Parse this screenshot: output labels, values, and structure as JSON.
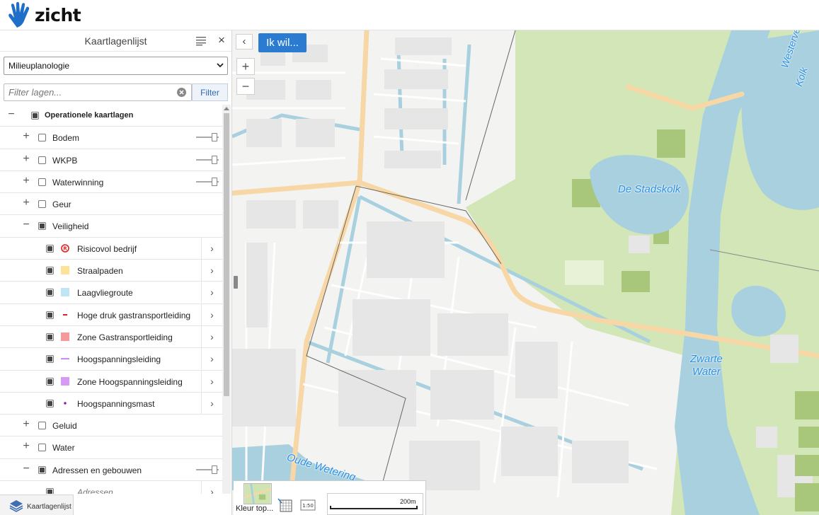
{
  "header": {
    "logo_text": "zicht",
    "logo_icon": "hand-icon"
  },
  "panel": {
    "title": "Kaartlagenlijst",
    "menu_icon": "list-icon",
    "close_label": "×",
    "theme_select": {
      "value": "Milieuplanologie"
    },
    "filter": {
      "placeholder": "Filter lagen...",
      "button_label": "Filter"
    },
    "footer_tab_label": "Kaartlagenlijst"
  },
  "tree": {
    "root": {
      "label": "Operationele kaartlagen",
      "checked": true,
      "expanded": true
    },
    "groups": [
      {
        "label": "Bodem",
        "checked": false,
        "expanded": false,
        "has_slider": true
      },
      {
        "label": "WKPB",
        "checked": false,
        "expanded": false,
        "has_slider": true
      },
      {
        "label": "Waterwinning",
        "checked": false,
        "expanded": false,
        "has_slider": true
      },
      {
        "label": "Geur",
        "checked": false,
        "expanded": false,
        "has_slider": false
      },
      {
        "label": "Veiligheid",
        "checked": true,
        "expanded": true,
        "has_slider": false
      },
      {
        "label": "Geluid",
        "checked": false,
        "expanded": false,
        "has_slider": false
      },
      {
        "label": "Water",
        "checked": false,
        "expanded": false,
        "has_slider": false
      },
      {
        "label": "Adressen en gebouwen",
        "checked": true,
        "expanded": true,
        "has_slider": true
      }
    ],
    "veiligheid_layers": [
      {
        "label": "Risicovol bedrijf",
        "checked": true,
        "legend": "risk-symbol",
        "color": "#e02020"
      },
      {
        "label": "Straalpaden",
        "checked": true,
        "legend": "fill",
        "color": "#fde29a"
      },
      {
        "label": "Laagvliegroute",
        "checked": true,
        "legend": "fill",
        "color": "#bfe6f7"
      },
      {
        "label": "Hoge druk gastransportleiding",
        "checked": true,
        "legend": "line",
        "color": "#e02020"
      },
      {
        "label": "Zone Gastransportleiding",
        "checked": true,
        "legend": "fill",
        "color": "#f59a9a"
      },
      {
        "label": "Hoogspanningsleiding",
        "checked": true,
        "legend": "line",
        "color": "#b23ae8"
      },
      {
        "label": "Zone Hoogspanningsleiding",
        "checked": true,
        "legend": "fill",
        "color": "#d79af2"
      },
      {
        "label": "Hoogspanningsmast",
        "checked": true,
        "legend": "dot",
        "color": "#8a1aa8"
      }
    ],
    "adressen_layers": [
      {
        "label": "Adressen",
        "checked": true
      }
    ]
  },
  "map": {
    "collapse_label": "‹",
    "ikwil_label": "Ik wil...",
    "zoom_in": "+",
    "zoom_out": "−",
    "labels": {
      "stadskolk": "De  Stadskolk",
      "westervelde_1": "Westervelde",
      "westervelde_2": "Kolk",
      "zwarte_1": "Zwarte",
      "zwarte_2": "Water",
      "oude_wetering": "Oude  Wetering"
    },
    "basemap_label": "Kleur top...",
    "scale_label": "200m",
    "colors": {
      "water": "#a9d0df",
      "park": "#cfe3b3",
      "road": "#f7d7a5",
      "building": "#e9e9e9",
      "urban": "#f4f4f2"
    }
  }
}
